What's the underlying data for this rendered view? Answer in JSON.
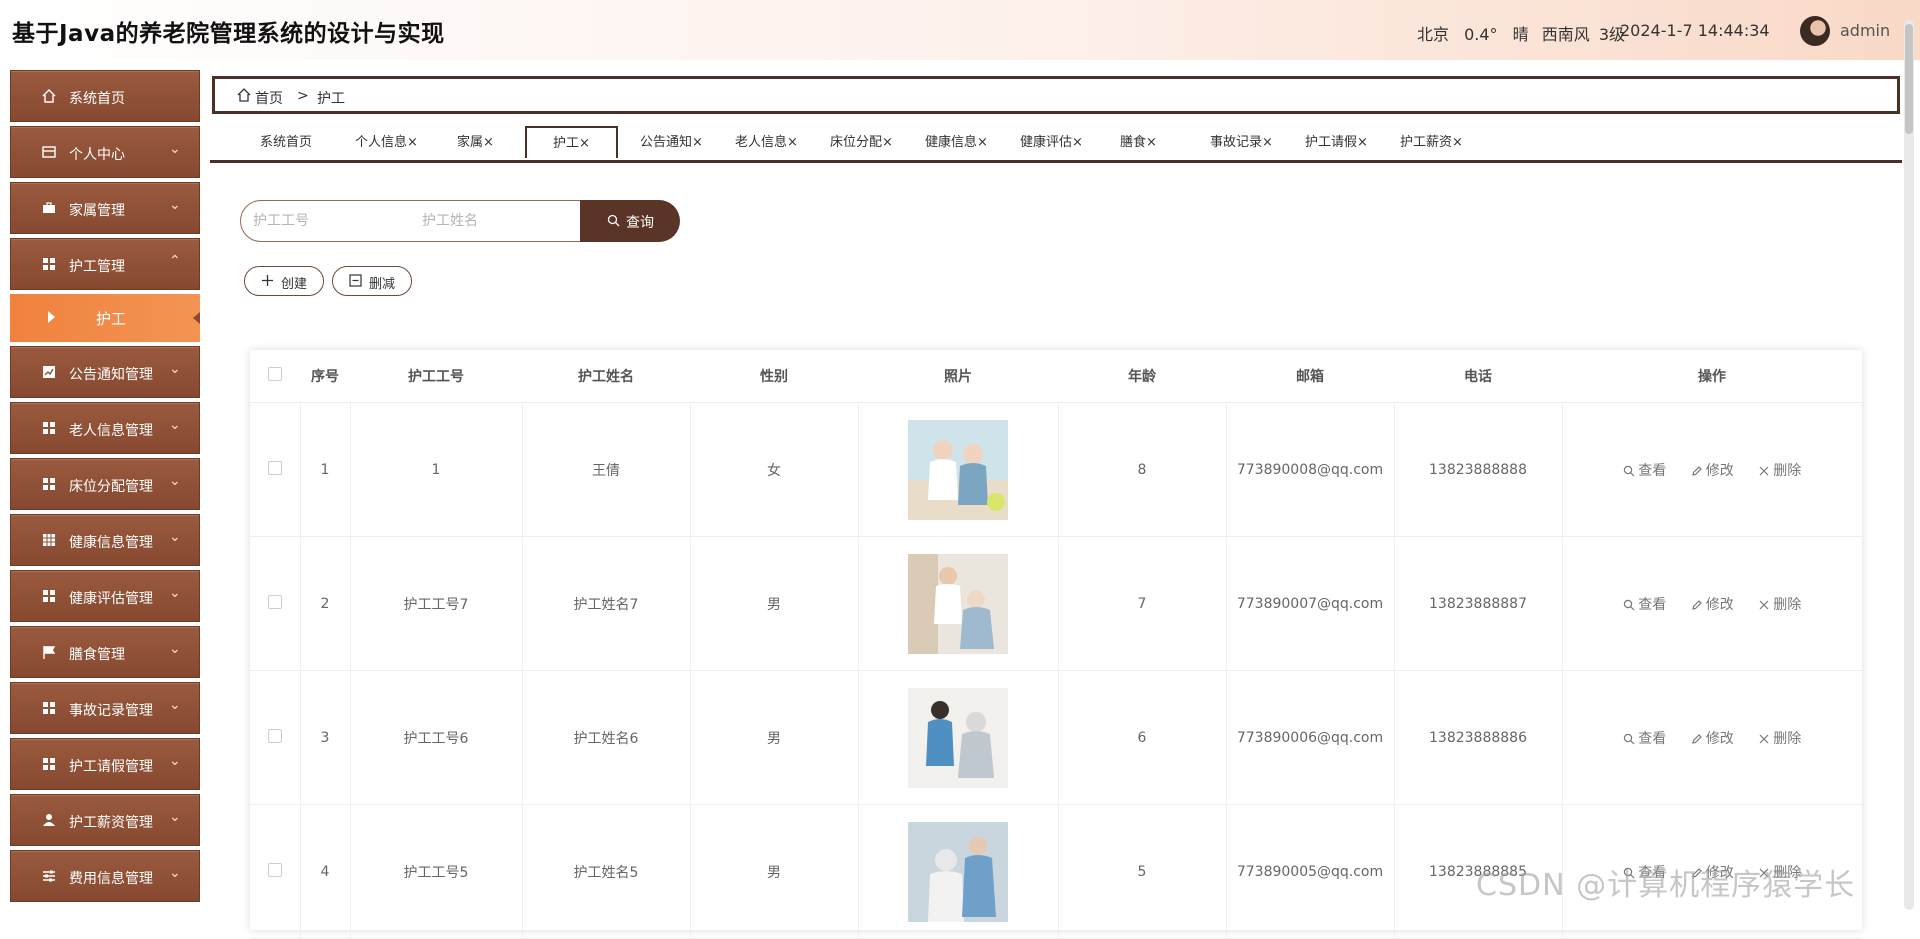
{
  "header": {
    "title": "基于Java的养老院管理系统的设计与实现",
    "weather": {
      "city": "北京",
      "temp": "0.4°",
      "condition": "晴",
      "wind": "西南风",
      "level": "3级"
    },
    "datetime": "2024-1-7 14:44:34",
    "user": "admin"
  },
  "sidebar": {
    "items": [
      {
        "label": "系统首页",
        "icon": "home-icon"
      },
      {
        "label": "个人中心",
        "icon": "card-icon"
      },
      {
        "label": "家属管理",
        "icon": "briefcase-icon"
      },
      {
        "label": "护工管理",
        "icon": "grid-icon",
        "expanded": true
      },
      {
        "label": "公告通知管理",
        "icon": "chart-icon"
      },
      {
        "label": "老人信息管理",
        "icon": "grid-icon"
      },
      {
        "label": "床位分配管理",
        "icon": "grid-icon"
      },
      {
        "label": "健康信息管理",
        "icon": "table-icon"
      },
      {
        "label": "健康评估管理",
        "icon": "grid-icon"
      },
      {
        "label": "膳食管理",
        "icon": "flag-icon"
      },
      {
        "label": "事故记录管理",
        "icon": "grid-icon"
      },
      {
        "label": "护工请假管理",
        "icon": "grid-icon"
      },
      {
        "label": "护工薪资管理",
        "icon": "user-icon"
      },
      {
        "label": "费用信息管理",
        "icon": "sliders-icon"
      }
    ],
    "submenu": {
      "label": "护工"
    }
  },
  "breadcrumb": {
    "home": "首页",
    "separator": ">",
    "current": "护工"
  },
  "tabs": [
    {
      "label": "系统首页"
    },
    {
      "label": "个人信息×"
    },
    {
      "label": "家属×"
    },
    {
      "label": "护工×",
      "active": true
    },
    {
      "label": "公告通知×"
    },
    {
      "label": "老人信息×"
    },
    {
      "label": "床位分配×"
    },
    {
      "label": "健康信息×"
    },
    {
      "label": "健康评估×"
    },
    {
      "label": "膳食×"
    },
    {
      "label": "事故记录×"
    },
    {
      "label": "护工请假×"
    },
    {
      "label": "护工薪资×"
    }
  ],
  "search": {
    "no_placeholder": "护工工号",
    "name_placeholder": "护工姓名",
    "button_label": "查询"
  },
  "actions": {
    "create": "创建",
    "delete": "删减"
  },
  "table": {
    "columns": [
      "序号",
      "护工工号",
      "护工姓名",
      "性别",
      "照片",
      "年龄",
      "邮箱",
      "电话",
      "操作"
    ],
    "rows": [
      {
        "index": "1",
        "no": "1",
        "name": "王倩",
        "gender": "女",
        "age": "8",
        "email": "773890008@qq.com",
        "phone": "13823888888"
      },
      {
        "index": "2",
        "no": "护工工号7",
        "name": "护工姓名7",
        "gender": "男",
        "age": "7",
        "email": "773890007@qq.com",
        "phone": "13823888887"
      },
      {
        "index": "3",
        "no": "护工工号6",
        "name": "护工姓名6",
        "gender": "男",
        "age": "6",
        "email": "773890006@qq.com",
        "phone": "13823888886"
      },
      {
        "index": "4",
        "no": "护工工号5",
        "name": "护工姓名5",
        "gender": "男",
        "age": "5",
        "email": "773890005@qq.com",
        "phone": "13823888885"
      }
    ],
    "ops": {
      "view": "查看",
      "edit": "修改",
      "delete": "删除"
    }
  },
  "watermark": "CSDN @计算机程序猿学长",
  "colors": {
    "sidebar": "#8f4f35",
    "active_submenu": "#f0823e",
    "primary_dark": "#5a3527"
  }
}
